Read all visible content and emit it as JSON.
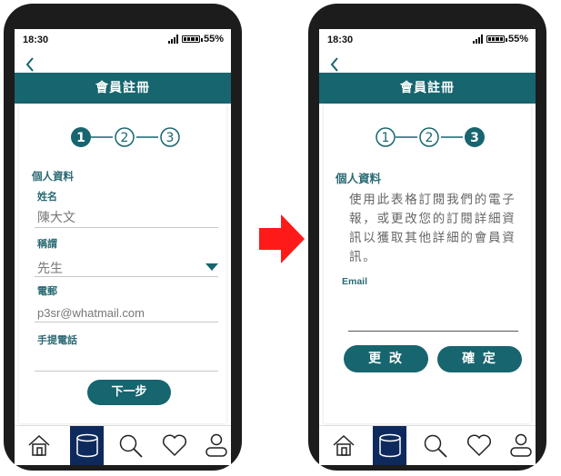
{
  "left": {
    "status": {
      "time": "18:30",
      "battery": "55%"
    },
    "header_title": "會員註冊",
    "steps": [
      "1",
      "2",
      "3"
    ],
    "current_step": 1,
    "section_label": "個人資料",
    "fields": {
      "name_label": "姓名",
      "name_value": "陳大文",
      "title_label": "稱謂",
      "title_value": "先生",
      "email_label": "電郵",
      "email_value": "p3sr@whatmail.com",
      "phone_label": "手提電話",
      "phone_value": ""
    },
    "next_button": "下一步"
  },
  "right": {
    "status": {
      "time": "18:30",
      "battery": "55%"
    },
    "header_title": "會員註冊",
    "steps": [
      "1",
      "2",
      "3"
    ],
    "current_step": 3,
    "section_label": "個人資料",
    "paragraph": [
      "使用此表格訂閱我們的電子",
      "報，或更改您的訂閱詳細資",
      "訊以獲取其他詳細的會員資",
      "訊。"
    ],
    "email_label": "Email",
    "email_value": "",
    "change_button": "更 改",
    "confirm_button": "確 定"
  },
  "tabbar": {
    "items": [
      "home-icon",
      "database-icon",
      "search-icon",
      "heart-icon",
      "user-icon"
    ],
    "active_index": 1
  },
  "colors": {
    "teal": "#17656e",
    "navy": "#0e2a5c",
    "arrow_red": "#ff1a1a",
    "phone_frame": "#1c1c1c"
  }
}
